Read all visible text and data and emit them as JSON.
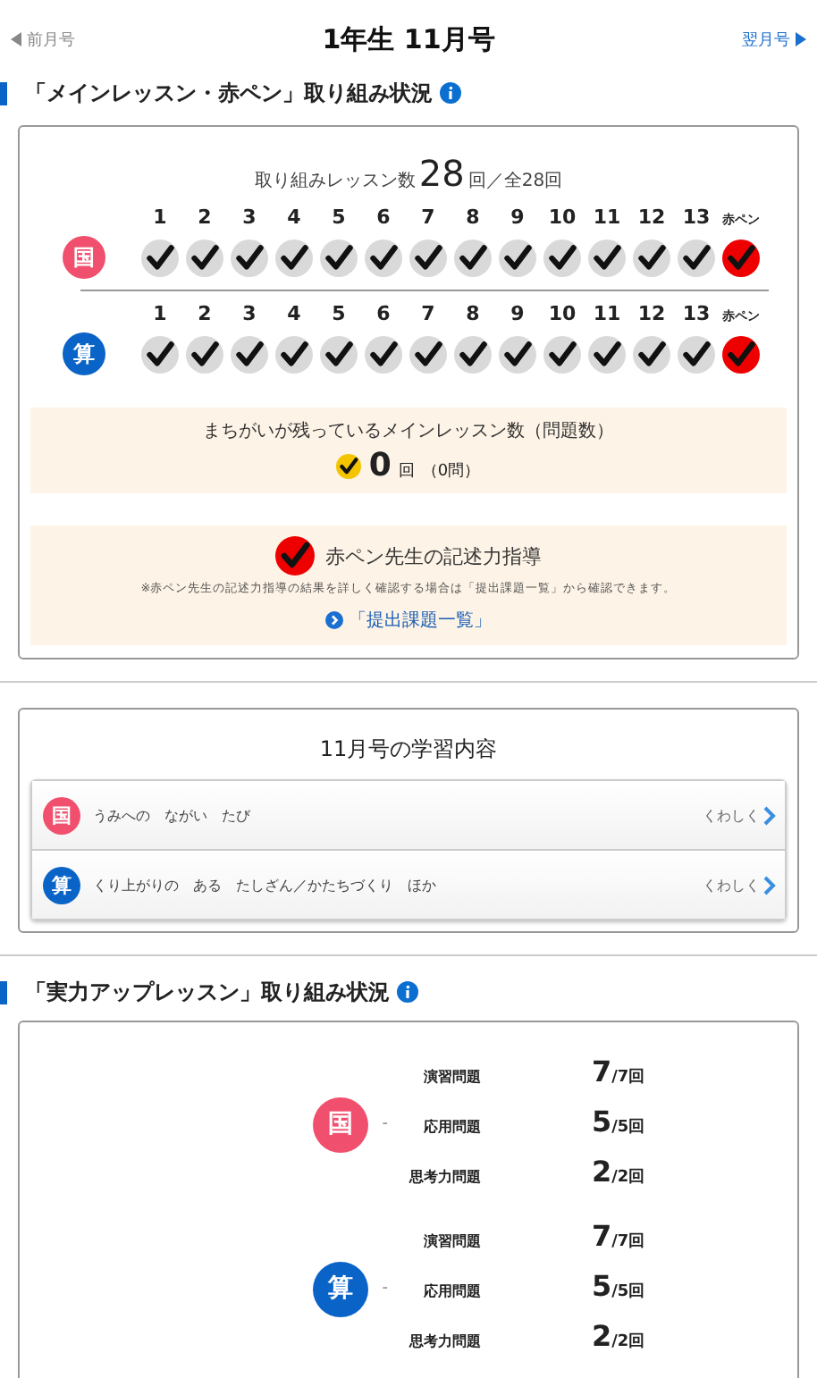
{
  "nav": {
    "prev": "前月号",
    "title": "1年生 11月号",
    "next": "翌月号"
  },
  "main_section": {
    "heading": "「メインレッスン・赤ペン」取り組み状況",
    "count_label": "取り組みレッスン数",
    "count": "28",
    "count_unit": "回／全28回",
    "subjects": [
      {
        "badge": "国",
        "color": "#f0506e",
        "lessons": [
          {
            "label": "1",
            "kind": "lesson",
            "checked": true
          },
          {
            "label": "2",
            "kind": "lesson",
            "checked": true
          },
          {
            "label": "3",
            "kind": "lesson",
            "checked": true
          },
          {
            "label": "4",
            "kind": "lesson",
            "checked": true
          },
          {
            "label": "5",
            "kind": "lesson",
            "checked": true
          },
          {
            "label": "6",
            "kind": "lesson",
            "checked": true
          },
          {
            "label": "7",
            "kind": "lesson",
            "checked": true
          },
          {
            "label": "8",
            "kind": "lesson",
            "checked": true
          },
          {
            "label": "9",
            "kind": "lesson",
            "checked": true
          },
          {
            "label": "10",
            "kind": "lesson",
            "checked": true
          },
          {
            "label": "11",
            "kind": "lesson",
            "checked": true
          },
          {
            "label": "12",
            "kind": "lesson",
            "checked": true
          },
          {
            "label": "13",
            "kind": "lesson",
            "checked": true
          },
          {
            "label": "赤ペン",
            "kind": "akapen",
            "checked": true
          }
        ]
      },
      {
        "badge": "算",
        "color": "#0a64c8",
        "lessons": [
          {
            "label": "1",
            "kind": "lesson",
            "checked": true
          },
          {
            "label": "2",
            "kind": "lesson",
            "checked": true
          },
          {
            "label": "3",
            "kind": "lesson",
            "checked": true
          },
          {
            "label": "4",
            "kind": "lesson",
            "checked": true
          },
          {
            "label": "5",
            "kind": "lesson",
            "checked": true
          },
          {
            "label": "6",
            "kind": "lesson",
            "checked": true
          },
          {
            "label": "7",
            "kind": "lesson",
            "checked": true
          },
          {
            "label": "8",
            "kind": "lesson",
            "checked": true
          },
          {
            "label": "9",
            "kind": "lesson",
            "checked": true
          },
          {
            "label": "10",
            "kind": "lesson",
            "checked": true
          },
          {
            "label": "11",
            "kind": "lesson",
            "checked": true
          },
          {
            "label": "12",
            "kind": "lesson",
            "checked": true
          },
          {
            "label": "13",
            "kind": "lesson",
            "checked": true
          },
          {
            "label": "赤ペン",
            "kind": "akapen",
            "checked": true
          }
        ]
      }
    ],
    "mistakes": {
      "label": "まちがいが残っているメインレッスン数（問題数）",
      "count": "0",
      "unit": "回",
      "questions": "（0問）"
    },
    "guidance": {
      "title": "赤ペン先生の記述力指導",
      "checked": true,
      "note": "※赤ペン先生の記述力指導の結果を詳しく確認する場合は「提出課題一覧」から確認できます。",
      "link": "「提出課題一覧」"
    }
  },
  "contents": {
    "title": "11月号の学習内容",
    "rows": [
      {
        "badge": "国",
        "color": "#f0506e",
        "text": "うみへの　ながい　たび",
        "more": "くわしく"
      },
      {
        "badge": "算",
        "color": "#0a64c8",
        "text": "くり上がりの　ある　たしざん／かたちづくり　ほか",
        "more": "くわしく"
      }
    ]
  },
  "practice_section": {
    "heading": "「実力アップレッスン」取り組み状況",
    "groups": [
      {
        "badge": "国",
        "color": "#f0506e",
        "dash": "-",
        "rows": [
          {
            "label": "演習問題",
            "done": "7",
            "total": "/7回"
          },
          {
            "label": "応用問題",
            "done": "5",
            "total": "/5回"
          },
          {
            "label": "思考力問題",
            "done": "2",
            "total": "/2回"
          }
        ]
      },
      {
        "badge": "算",
        "color": "#0a64c8",
        "dash": "-",
        "rows": [
          {
            "label": "演習問題",
            "done": "7",
            "total": "/7回"
          },
          {
            "label": "応用問題",
            "done": "5",
            "total": "/5回"
          },
          {
            "label": "思考力問題",
            "done": "2",
            "total": "/2回"
          }
        ]
      }
    ]
  }
}
